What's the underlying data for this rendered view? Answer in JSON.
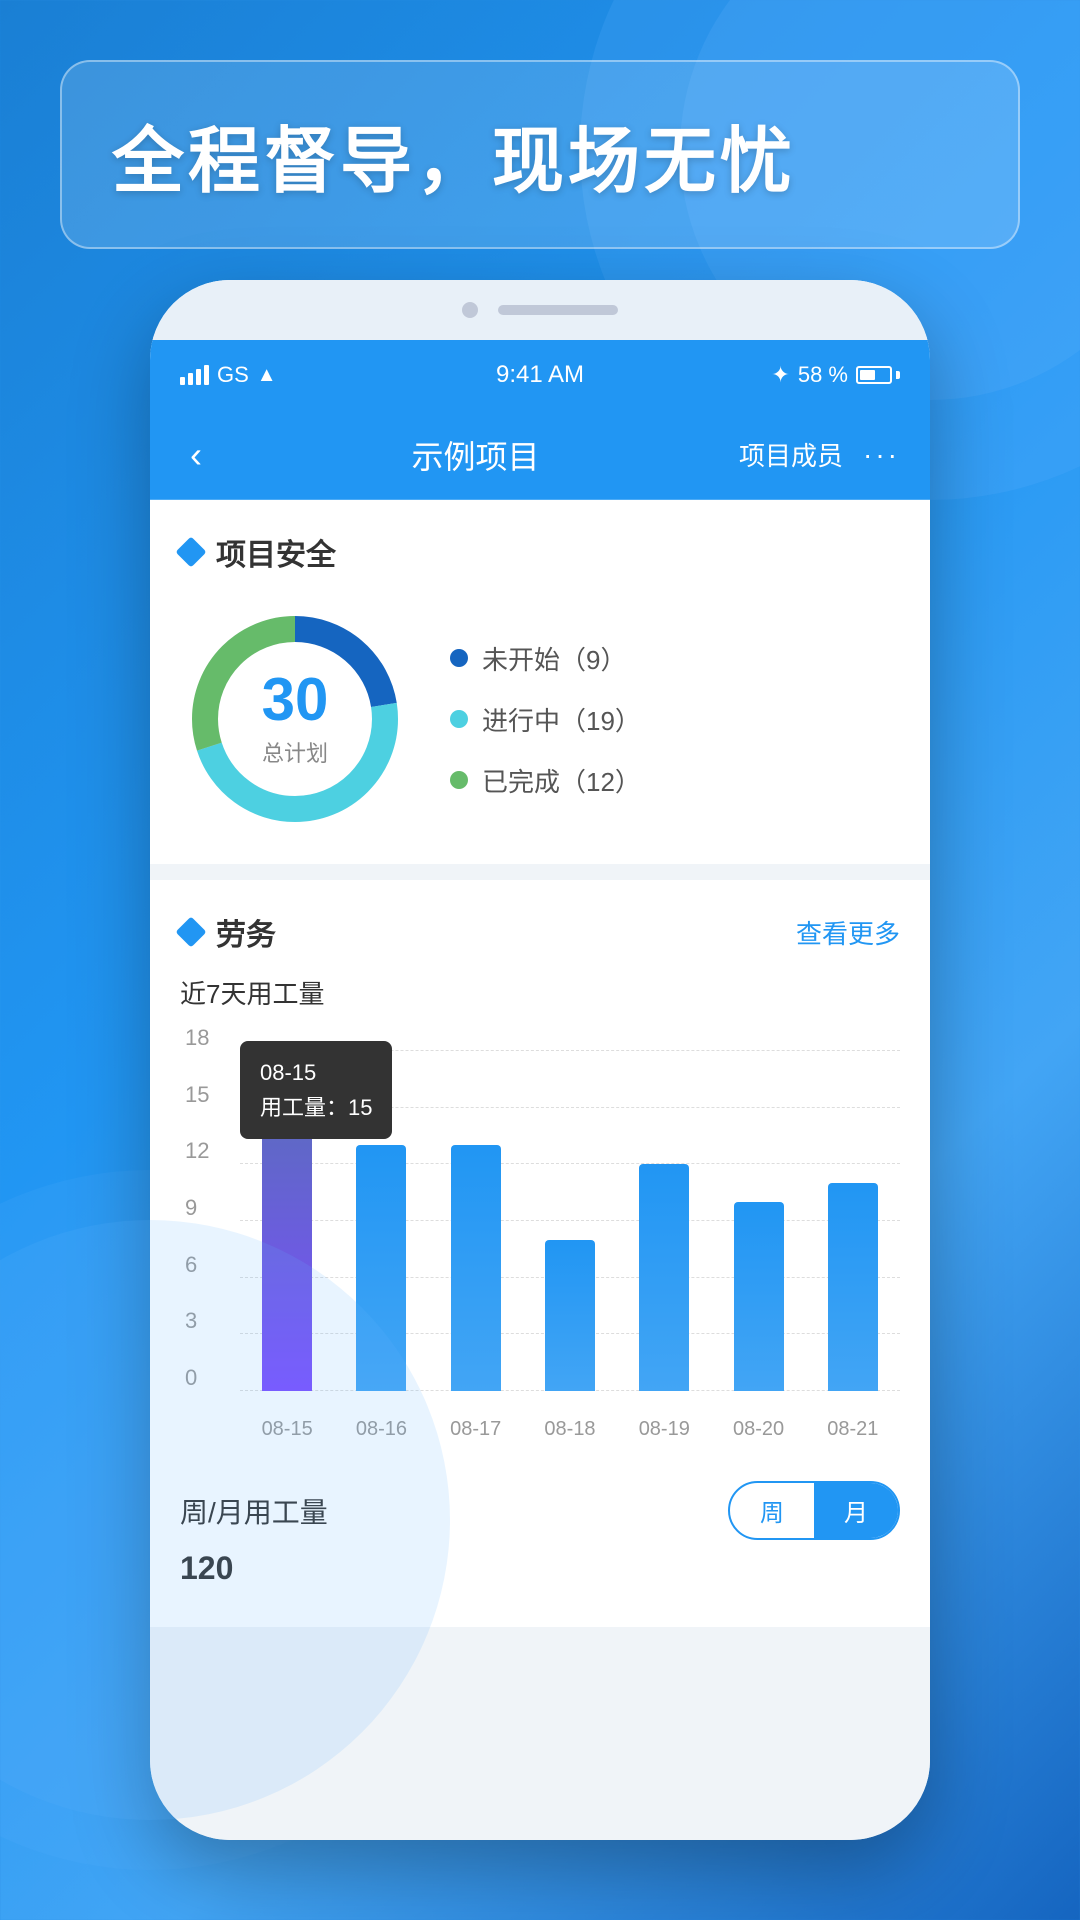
{
  "header": {
    "banner_text": "全程督导，现场无忧"
  },
  "status_bar": {
    "carrier": "GS",
    "time": "9:41 AM",
    "battery_percent": "58 %"
  },
  "nav": {
    "back_icon": "‹",
    "title": "示例项目",
    "member_label": "项目成员",
    "more_icon": "···"
  },
  "project_safety": {
    "section_title": "项目安全",
    "total_number": "30",
    "total_label": "总计划",
    "legend": [
      {
        "color": "#1565c0",
        "label": "未开始（9）"
      },
      {
        "color": "#26c6da",
        "label": "进行中（19）"
      },
      {
        "color": "#66bb6a",
        "label": "已完成（12）"
      }
    ],
    "donut_segments": [
      {
        "value": 9,
        "color": "#1565c0"
      },
      {
        "value": 19,
        "color": "#4dd0e1"
      },
      {
        "value": 12,
        "color": "#66bb6a"
      }
    ]
  },
  "labor": {
    "section_title": "劳务",
    "view_more": "查看更多",
    "chart_subtitle": "近7天用工量",
    "tooltip": {
      "date": "08-15",
      "label": "用工量：15"
    },
    "y_axis": [
      0,
      3,
      6,
      9,
      12,
      15,
      18
    ],
    "bars": [
      {
        "date": "08-15",
        "value": 15,
        "highlighted": true
      },
      {
        "date": "08-16",
        "value": 13
      },
      {
        "date": "08-17",
        "value": 13
      },
      {
        "date": "08-18",
        "value": 8
      },
      {
        "date": "08-19",
        "value": 12
      },
      {
        "date": "08-20",
        "value": 10
      },
      {
        "date": "08-21",
        "value": 11
      }
    ],
    "period_title": "周/月用工量",
    "period_value": "120",
    "period_options": [
      "周",
      "月"
    ],
    "active_period": "月"
  }
}
